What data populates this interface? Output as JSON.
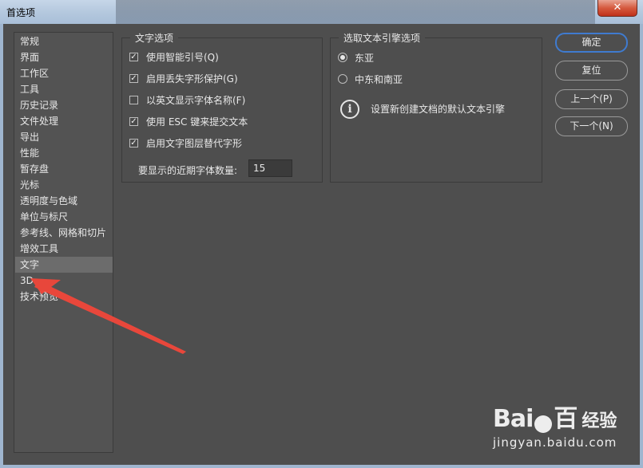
{
  "window": {
    "title": "首选项",
    "close_glyph": "✕"
  },
  "nav": {
    "items": [
      {
        "label": "常规",
        "selected": false
      },
      {
        "label": "界面",
        "selected": false
      },
      {
        "label": "工作区",
        "selected": false
      },
      {
        "label": "工具",
        "selected": false
      },
      {
        "label": "历史记录",
        "selected": false
      },
      {
        "label": "文件处理",
        "selected": false
      },
      {
        "label": "导出",
        "selected": false
      },
      {
        "label": "性能",
        "selected": false
      },
      {
        "label": "暂存盘",
        "selected": false
      },
      {
        "label": "光标",
        "selected": false
      },
      {
        "label": "透明度与色域",
        "selected": false
      },
      {
        "label": "单位与标尺",
        "selected": false
      },
      {
        "label": "参考线、网格和切片",
        "selected": false
      },
      {
        "label": "增效工具",
        "selected": false
      },
      {
        "label": "文字",
        "selected": true
      },
      {
        "label": "3D",
        "selected": false
      },
      {
        "label": "技术预览",
        "selected": false
      }
    ]
  },
  "type_options": {
    "title": "文字选项",
    "checkboxes": [
      {
        "label": "使用智能引号(Q)",
        "checked": true
      },
      {
        "label": "启用丢失字形保护(G)",
        "checked": true
      },
      {
        "label": "以英文显示字体名称(F)",
        "checked": false
      },
      {
        "label": "使用 ESC 键来提交文本",
        "checked": true
      },
      {
        "label": "启用文字图层替代字形",
        "checked": true
      }
    ],
    "recent_fonts_label": "要显示的近期字体数量:",
    "recent_fonts_value": "15",
    "check_glyph": "✓"
  },
  "engine_options": {
    "title": "选取文本引擎选项",
    "radios": [
      {
        "label": "东亚",
        "selected": true
      },
      {
        "label": "中东和南亚",
        "selected": false
      }
    ],
    "info_glyph": "i",
    "info_text": "设置新创建文档的默认文本引擎"
  },
  "buttons": {
    "ok": "确定",
    "reset": "复位",
    "prev": "上一个(P)",
    "next": "下一个(N)"
  },
  "annotation": {
    "arrow_color": "#e8473b"
  },
  "watermark": {
    "logo": "Bai",
    "logo_end": "百",
    "brand": "经验",
    "url": "jingyan.baidu.com"
  }
}
